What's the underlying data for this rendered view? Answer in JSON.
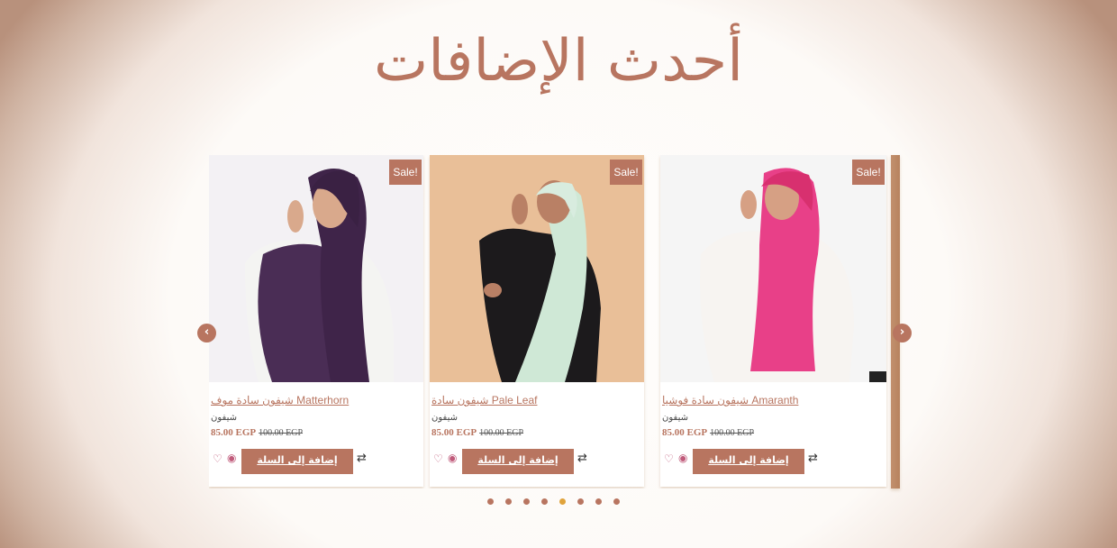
{
  "section_title": "أحدث الإضافات",
  "colors": {
    "accent": "#b87560",
    "active_dot": "#e0a33b",
    "wishlist": "#c05a7a"
  },
  "icons": {
    "wishlist": "heart-icon",
    "quick_view": "eye-icon",
    "compare": "compare-arrows-icon",
    "prev": "chevron-left-icon",
    "next": "chevron-right-icon"
  },
  "products": [
    {
      "name": "شيفون سادة موف Matterhorn",
      "category": "شيفون",
      "price": "85.00 EGP",
      "old_price": "100.00 EGP",
      "badge": "Sale!",
      "cart_label": "إضافة إلى السلة"
    },
    {
      "name": "شيفون سادة Pale Leaf",
      "category": "شيفون",
      "price": "85.00 EGP",
      "old_price": "100.00 EGP",
      "badge": "Sale!",
      "cart_label": "إضافة إلى السلة"
    },
    {
      "name": "شيفون سادة فوشيا Amaranth",
      "category": "شيفون",
      "price": "85.00 EGP",
      "old_price": "100.00 EGP",
      "badge": "Sale!",
      "cart_label": "إضافة إلى السلة"
    }
  ],
  "pagination": {
    "count": 8,
    "active_index": 4
  }
}
